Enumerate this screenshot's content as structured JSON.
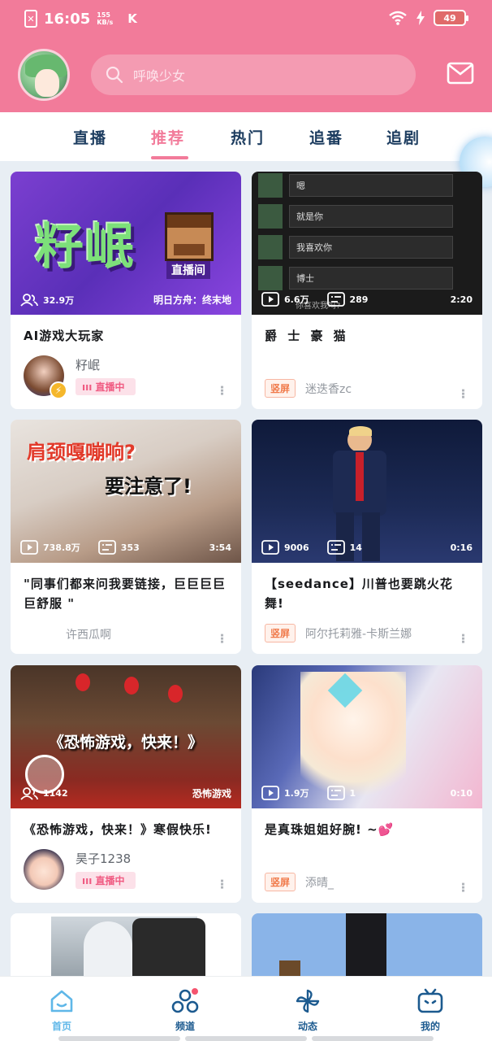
{
  "status_bar": {
    "time": "16:05",
    "net_speed_value": "155",
    "net_speed_unit": "KB/s",
    "app_indicator": "K",
    "battery": "49"
  },
  "header": {
    "search_placeholder": "呼唤少女",
    "mail_icon": "mail-icon"
  },
  "tabs": [
    {
      "label": "直播",
      "active": false
    },
    {
      "label": "推荐",
      "active": true
    },
    {
      "label": "热门",
      "active": false
    },
    {
      "label": "追番",
      "active": false
    },
    {
      "label": "追剧",
      "active": false
    }
  ],
  "cards": [
    {
      "thumb_label_main": "籽岷",
      "thumb_label_sub": "直播间",
      "viewers": "32.9万",
      "category": "明日方舟：终末地",
      "title": "AI游戏大玩家",
      "uploader": "籽岷",
      "badge": "直播中"
    },
    {
      "chat_lines": [
        "嗯",
        "就是你",
        "我喜欢你",
        "博士",
        "你喜欢我吗?"
      ],
      "views": "6.6万",
      "danmaku": "289",
      "duration": "2:20",
      "title": "爵 士 豪 猫",
      "tag": "竖屏",
      "uploader": "迷迭香zc"
    },
    {
      "overlay_line1": "肩颈嘎嘣响?",
      "overlay_line2": "要注意了!",
      "views": "738.8万",
      "danmaku": "353",
      "duration": "3:54",
      "title": "\"同事们都来问我要链接，巨巨巨巨巨舒服 \"",
      "uploader": "许西瓜啊"
    },
    {
      "views": "9006",
      "danmaku": "14",
      "duration": "0:16",
      "title": "【seedance】川普也要跳火花舞!",
      "tag": "竖屏",
      "uploader": "阿尔托莉雅-卡斯兰娜"
    },
    {
      "overlay_title": "《恐怖游戏，快来！》",
      "viewers": "1142",
      "category": "恐怖游戏",
      "title": "《恐怖游戏，快来！》寒假快乐!",
      "uploader": "昊子1238",
      "badge": "直播中"
    },
    {
      "views": "1.9万",
      "danmaku": "1",
      "duration": "0:10",
      "title": "是真珠姐姐好腕! ~💕",
      "tag": "竖屏",
      "uploader": "添晴_"
    }
  ],
  "bottom_nav": [
    {
      "label": "首页",
      "icon": "home-icon",
      "active": true
    },
    {
      "label": "频道",
      "icon": "channel-icon",
      "active": false
    },
    {
      "label": "动态",
      "icon": "pinwheel-icon",
      "active": false
    },
    {
      "label": "我的",
      "icon": "tv-icon",
      "active": false
    }
  ],
  "colors": {
    "brand_pink": "#f27b9a",
    "nav_active": "#5fb7e8",
    "tag_orange": "#f07a4a"
  }
}
